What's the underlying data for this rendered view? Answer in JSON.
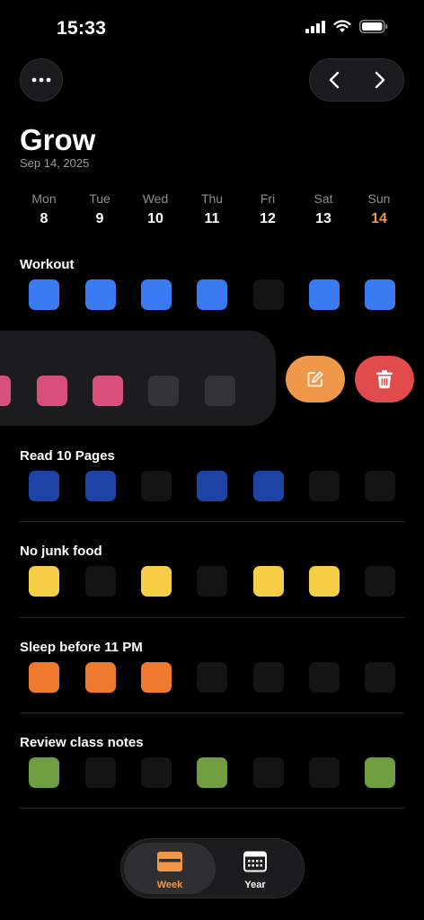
{
  "status_bar": {
    "time": "15:33"
  },
  "header": {
    "title": "Grow",
    "date": "Sep 14, 2025"
  },
  "week": [
    {
      "name": "Mon",
      "num": "8"
    },
    {
      "name": "Tue",
      "num": "9"
    },
    {
      "name": "Wed",
      "num": "10"
    },
    {
      "name": "Thu",
      "num": "11"
    },
    {
      "name": "Fri",
      "num": "12"
    },
    {
      "name": "Sat",
      "num": "13"
    },
    {
      "name": "Sun",
      "num": "14",
      "today": true
    }
  ],
  "colors": {
    "empty": "#141414",
    "empty_swiped": "#343436",
    "accent": "#f0974a",
    "delete": "#e24b4b"
  },
  "habits": [
    {
      "title": "Workout",
      "color": "#3a7bf2",
      "days": [
        1,
        1,
        1,
        1,
        0,
        1,
        1
      ]
    },
    {
      "title": "",
      "swiped": true,
      "color": "#d84f7c",
      "days": [
        1,
        1,
        1,
        0,
        0
      ]
    },
    {
      "title": "Read 10 Pages",
      "color": "#1d43a7",
      "days": [
        1,
        1,
        0,
        1,
        1,
        0,
        0
      ]
    },
    {
      "title": "No junk food",
      "color": "#f5ce45",
      "days": [
        1,
        0,
        1,
        0,
        1,
        1,
        0
      ]
    },
    {
      "title": "Sleep before 11 PM",
      "color": "#ef7a2f",
      "days": [
        1,
        1,
        1,
        0,
        0,
        0,
        0
      ]
    },
    {
      "title": "Review class notes",
      "color": "#6e9e3f",
      "days": [
        1,
        0,
        0,
        1,
        0,
        0,
        1
      ]
    }
  ],
  "tabs": [
    {
      "label": "Week",
      "icon": "week-calendar-icon",
      "active": true
    },
    {
      "label": "Year",
      "icon": "year-calendar-icon",
      "active": false
    }
  ]
}
